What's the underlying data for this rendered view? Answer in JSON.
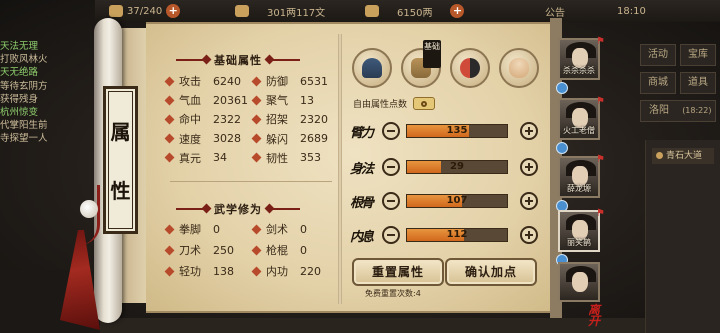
{
  "topbar": {
    "energy": "37/240",
    "money": "301两117文",
    "gold": "6150两",
    "notice": "公告",
    "time": "18:10"
  },
  "chat": {
    "lines": [
      {
        "text": "天法无理",
        "color": "g"
      },
      {
        "text": "打败风林火",
        "color": ""
      },
      {
        "text": "天无绝路",
        "color": "g"
      },
      {
        "text": "等待玄阴方",
        "color": ""
      },
      {
        "text": "获得残身",
        "color": ""
      },
      {
        "text": "杭州惊变",
        "color": "g"
      },
      {
        "text": "代掌阳生前",
        "color": ""
      },
      {
        "text": "寺探望一人",
        "color": ""
      }
    ]
  },
  "right_menu": {
    "buttons": [
      "活动",
      "宝库",
      "商城",
      "道具"
    ],
    "location": "洛阳",
    "location_time": "(18:22)",
    "quest": "青石大道"
  },
  "scroll": {
    "vertical_tab": [
      "属",
      "性"
    ]
  },
  "basic": {
    "title": "基础属性",
    "rows": [
      [
        {
          "label": "攻击",
          "value": "6240"
        },
        {
          "label": "防御",
          "value": "6531"
        }
      ],
      [
        {
          "label": "气血",
          "value": "20361"
        },
        {
          "label": "聚气",
          "value": "13"
        }
      ],
      [
        {
          "label": "命中",
          "value": "2322"
        },
        {
          "label": "招架",
          "value": "2320"
        }
      ],
      [
        {
          "label": "速度",
          "value": "3028"
        },
        {
          "label": "躲闪",
          "value": "2689"
        }
      ],
      [
        {
          "label": "真元",
          "value": "34"
        },
        {
          "label": "韧性",
          "value": "353"
        }
      ]
    ]
  },
  "martial": {
    "title": "武学修为",
    "rows": [
      [
        {
          "label": "拳脚",
          "value": "0"
        },
        {
          "label": "剑术",
          "value": "0"
        }
      ],
      [
        {
          "label": "刀术",
          "value": "250"
        },
        {
          "label": "枪棍",
          "value": "0"
        }
      ],
      [
        {
          "label": "轻功",
          "value": "138"
        },
        {
          "label": "内功",
          "value": "220"
        }
      ]
    ]
  },
  "tag_plate": "基础",
  "free_points_label": "自由属性点数",
  "stats": [
    {
      "name": "臂力",
      "value": "135",
      "fill": 0.62
    },
    {
      "name": "身法",
      "value": "29",
      "fill": 0.34
    },
    {
      "name": "根骨",
      "value": "107",
      "fill": 0.55
    },
    {
      "name": "内息",
      "value": "112",
      "fill": 0.57
    }
  ],
  "buttons": {
    "reset": "重置属性",
    "confirm": "确认加点"
  },
  "reset_note": "免费重置次数:4",
  "characters": [
    {
      "name": "杀杀杀杀",
      "selected": false
    },
    {
      "name": "火工老僧",
      "selected": false
    },
    {
      "name": "薛龙塬",
      "selected": false
    },
    {
      "name": "丽笑鹊",
      "selected": true
    },
    {
      "name": "",
      "selected": false
    }
  ],
  "leave_label": "离开"
}
